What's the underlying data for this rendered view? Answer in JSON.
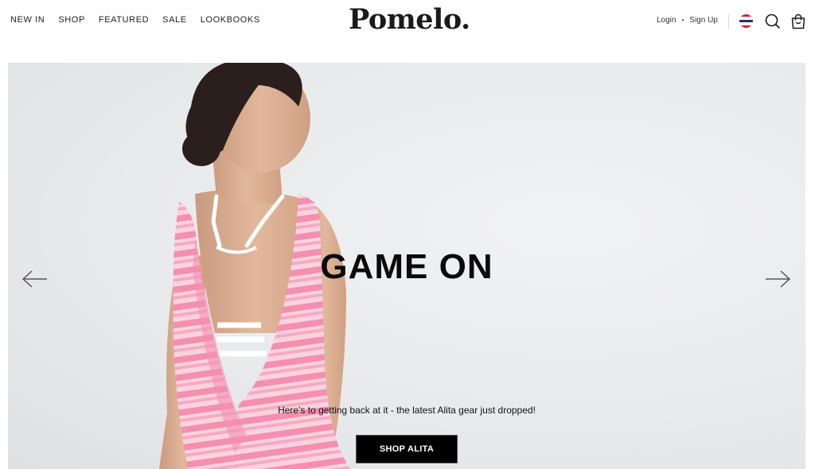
{
  "brand": {
    "logo_text": "Pomelo."
  },
  "nav": {
    "items": [
      {
        "label": "NEW IN"
      },
      {
        "label": "SHOP"
      },
      {
        "label": "FEATURED"
      },
      {
        "label": "SALE"
      },
      {
        "label": "LOOKBOOKS"
      }
    ]
  },
  "account": {
    "login_label": "Login",
    "separator": "•",
    "signup_label": "Sign Up"
  },
  "icons": {
    "flag": "thailand-flag-icon",
    "search": "search-icon",
    "cart": "shopping-bag-icon"
  },
  "hero": {
    "title": "GAME ON",
    "subtitle": "Here's to getting back at it - the latest Alita gear just dropped!",
    "cta_label": "SHOP ALITA",
    "prev_icon": "arrow-left-icon",
    "next_icon": "arrow-right-icon"
  },
  "colors": {
    "text": "#1a1a1a",
    "cta_bg": "#000000",
    "cta_text": "#ffffff",
    "hero_bg": "#e9eaec",
    "garment_pink": "#f48fb1"
  }
}
